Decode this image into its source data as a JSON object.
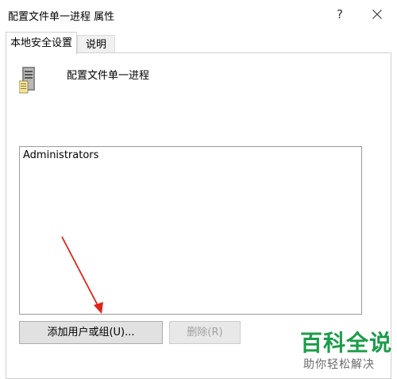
{
  "window": {
    "title": "配置文件单一进程 属性",
    "help_label": "?",
    "close_icon": "close-icon"
  },
  "tabs": [
    {
      "label": "本地安全设置",
      "active": true
    },
    {
      "label": "说明",
      "active": false
    }
  ],
  "policy": {
    "icon": "server-policy-icon",
    "name": "配置文件单一进程"
  },
  "members": [
    "Administrators"
  ],
  "buttons": {
    "add": "添加用户或组(U)...",
    "remove": "删除(R)"
  },
  "watermark": {
    "title": "百科全说",
    "subtitle": "助你轻松解决",
    "color": "#1c9c4a"
  }
}
